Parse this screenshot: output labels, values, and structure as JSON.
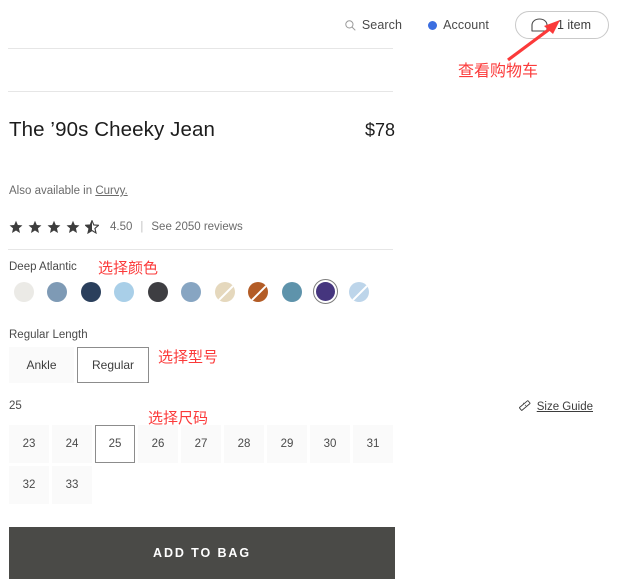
{
  "header": {
    "search_label": "Search",
    "search_icon": "search-icon",
    "account_label": "Account",
    "account_icon": "account-dot-icon",
    "cart_label": "1 item",
    "cart_icon": "shopping-bag-icon"
  },
  "product": {
    "title": "The ’90s Cheeky Jean",
    "price": "$78",
    "also_available_prefix": "Also available in ",
    "also_available_link": "Curvy.",
    "rating_value": "4.50",
    "rating_separator": "|",
    "reviews_label": "See 2050 reviews",
    "stars_filled": 4,
    "stars_half": 1,
    "stars_total": 5
  },
  "color": {
    "selected_name": "Deep Atlantic",
    "swatches": [
      {
        "name": "off-white",
        "hex": "#ebeae6",
        "striped": false,
        "selected": false
      },
      {
        "name": "slate-blue",
        "hex": "#7e9ab5",
        "striped": false,
        "selected": false
      },
      {
        "name": "deep-navy",
        "hex": "#2a3f5c",
        "striped": false,
        "selected": false
      },
      {
        "name": "light-sky-blue",
        "hex": "#a9cfe8",
        "striped": false,
        "selected": false
      },
      {
        "name": "charcoal",
        "hex": "#3e3e42",
        "striped": false,
        "selected": false
      },
      {
        "name": "dusty-blue",
        "hex": "#87a5c2",
        "striped": false,
        "selected": false
      },
      {
        "name": "ecru",
        "hex": "#e5d8bd",
        "striped": true,
        "selected": false
      },
      {
        "name": "rust-brown",
        "hex": "#b35c26",
        "striped": true,
        "selected": false
      },
      {
        "name": "teal-blue",
        "hex": "#5e93ab",
        "striped": false,
        "selected": false
      },
      {
        "name": "deep-atlantic",
        "hex": "#45357e",
        "striped": false,
        "selected": true
      },
      {
        "name": "pale-blue",
        "hex": "#bdd5ea",
        "striped": true,
        "selected": false
      }
    ]
  },
  "length": {
    "selected_label": "Regular Length",
    "options": [
      {
        "label": "Ankle",
        "selected": false
      },
      {
        "label": "Regular",
        "selected": true
      }
    ]
  },
  "size": {
    "selected_label": "25",
    "size_guide_label": "Size Guide",
    "size_guide_icon": "ruler-icon",
    "options": [
      {
        "label": "23",
        "selected": false
      },
      {
        "label": "24",
        "selected": false
      },
      {
        "label": "25",
        "selected": true
      },
      {
        "label": "26",
        "selected": false
      },
      {
        "label": "27",
        "selected": false
      },
      {
        "label": "28",
        "selected": false
      },
      {
        "label": "29",
        "selected": false
      },
      {
        "label": "30",
        "selected": false
      },
      {
        "label": "31",
        "selected": false
      },
      {
        "label": "32",
        "selected": false
      },
      {
        "label": "33",
        "selected": false
      }
    ]
  },
  "actions": {
    "add_to_bag_label": "ADD TO BAG"
  },
  "annotations": {
    "accent_color": "#fb3a3a",
    "cart": "查看购物车",
    "color": "选择颜色",
    "model": "选择型号",
    "size": "选择尺码"
  }
}
